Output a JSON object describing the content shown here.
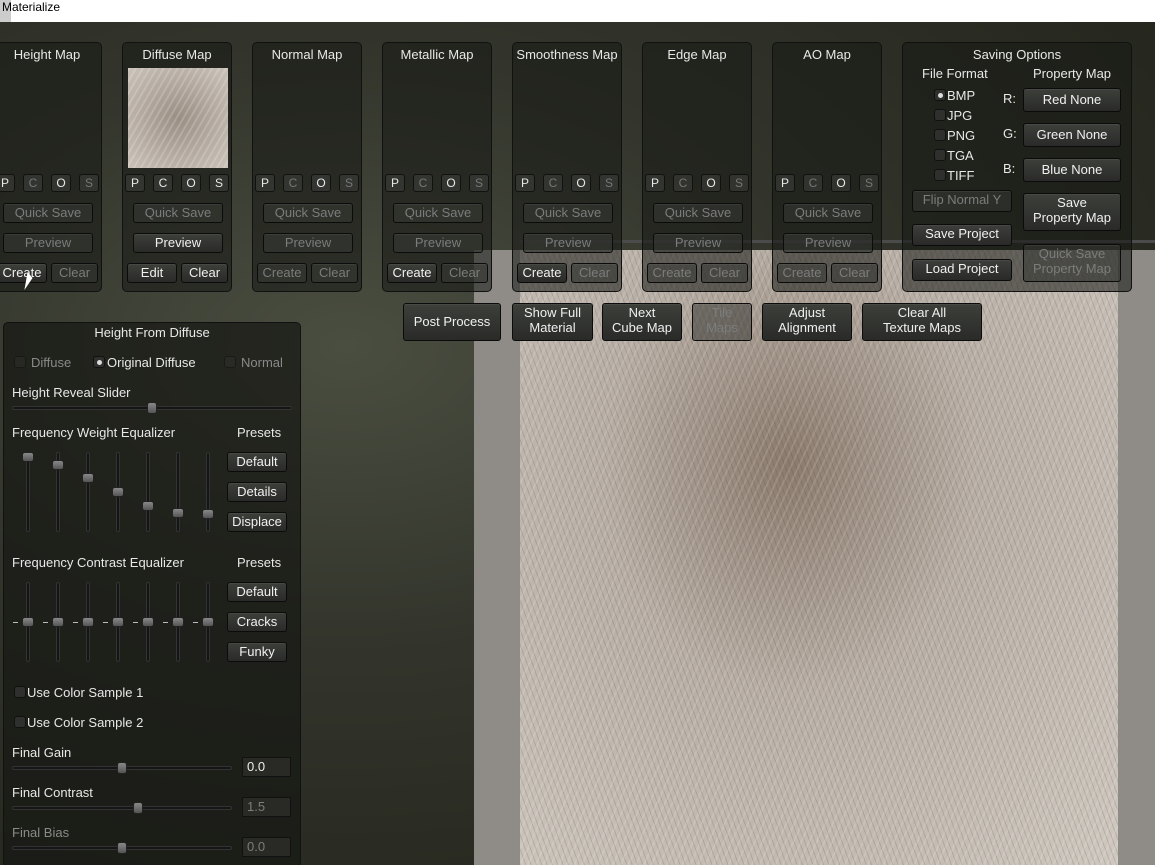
{
  "window": {
    "title": "Materialize"
  },
  "maps": [
    {
      "title": "Height Map",
      "buttons": {
        "p": "P",
        "c": "C",
        "o": "O",
        "s": "S"
      },
      "quick_save": "Quick Save",
      "preview": "Preview",
      "create": "Create",
      "clear": "Clear"
    },
    {
      "title": "Diffuse Map",
      "buttons": {
        "p": "P",
        "c": "C",
        "o": "O",
        "s": "S"
      },
      "quick_save": "Quick Save",
      "preview": "Preview",
      "create": "Edit",
      "clear": "Clear"
    },
    {
      "title": "Normal Map",
      "buttons": {
        "p": "P",
        "c": "C",
        "o": "O",
        "s": "S"
      },
      "quick_save": "Quick Save",
      "preview": "Preview",
      "create": "Create",
      "clear": "Clear"
    },
    {
      "title": "Metallic Map",
      "buttons": {
        "p": "P",
        "c": "C",
        "o": "O",
        "s": "S"
      },
      "quick_save": "Quick Save",
      "preview": "Preview",
      "create": "Create",
      "clear": "Clear"
    },
    {
      "title": "Smoothness Map",
      "buttons": {
        "p": "P",
        "c": "C",
        "o": "O",
        "s": "S"
      },
      "quick_save": "Quick Save",
      "preview": "Preview",
      "create": "Create",
      "clear": "Clear"
    },
    {
      "title": "Edge Map",
      "buttons": {
        "p": "P",
        "c": "C",
        "o": "O",
        "s": "S"
      },
      "quick_save": "Quick Save",
      "preview": "Preview",
      "create": "Create",
      "clear": "Clear"
    },
    {
      "title": "AO Map",
      "buttons": {
        "p": "P",
        "c": "C",
        "o": "O",
        "s": "S"
      },
      "quick_save": "Quick Save",
      "preview": "Preview",
      "create": "Create",
      "clear": "Clear"
    }
  ],
  "saving": {
    "title": "Saving Options",
    "file_format": "File Format",
    "property_map": "Property Map",
    "formats": [
      "BMP",
      "JPG",
      "PNG",
      "TGA",
      "TIFF"
    ],
    "selected_format": "BMP",
    "channel_r": "R:",
    "channel_g": "G:",
    "channel_b": "B:",
    "red": "Red None",
    "green": "Green None",
    "blue": "Blue None",
    "flip_normal": "Flip Normal Y",
    "save_property_1": "Save",
    "save_property_2": "Property Map",
    "save_project": "Save Project",
    "load_project": "Load Project",
    "quick_save_property_1": "Quick Save",
    "quick_save_property_2": "Property Map"
  },
  "toolbar": {
    "post_process": "Post Process",
    "show_full_1": "Show Full",
    "show_full_2": "Material",
    "next_cube_1": "Next",
    "next_cube_2": "Cube Map",
    "tile_maps_1": "Tile",
    "tile_maps_2": "Maps",
    "adjust_1": "Adjust",
    "adjust_2": "Alignment",
    "clear_all_1": "Clear All",
    "clear_all_2": "Texture Maps"
  },
  "height_panel": {
    "title": "Height From Diffuse",
    "source_diffuse": "Diffuse",
    "source_original": "Original Diffuse",
    "source_normal": "Normal",
    "selected_source": "Original Diffuse",
    "reveal_label": "Height Reveal Slider",
    "reveal_value": 0.5,
    "freq_weight_label": "Frequency Weight Equalizer",
    "presets": "Presets",
    "freq_weight_values": [
      1.0,
      0.88,
      0.7,
      0.5,
      0.3,
      0.2,
      0.18
    ],
    "weight_presets": [
      "Default",
      "Details",
      "Displace"
    ],
    "freq_contrast_label": "Frequency Contrast Equalizer",
    "freq_contrast_values": [
      0.5,
      0.5,
      0.5,
      0.5,
      0.5,
      0.5,
      0.5
    ],
    "contrast_presets": [
      "Default",
      "Cracks",
      "Funky"
    ],
    "color_sample_1": "Use Color Sample 1",
    "color_sample_2": "Use Color Sample 2",
    "final_gain_label": "Final Gain",
    "final_gain": "0.0",
    "final_contrast_label": "Final Contrast",
    "final_contrast": "1.5",
    "final_bias_label": "Final Bias",
    "final_bias": "0.0"
  }
}
